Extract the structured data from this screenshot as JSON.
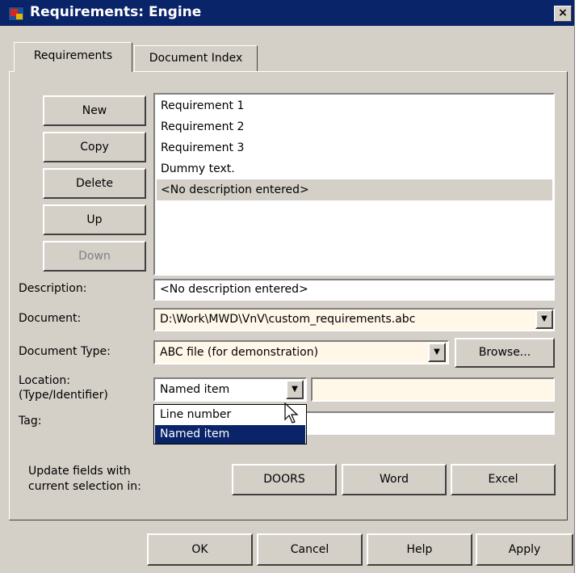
{
  "window": {
    "title": "Requirements: Engine",
    "close_label": "×"
  },
  "tabs": [
    {
      "label": "Requirements"
    },
    {
      "label": "Document Index"
    }
  ],
  "buttons": {
    "new": "New",
    "copy": "Copy",
    "delete": "Delete",
    "up": "Up",
    "down": "Down",
    "browse": "Browse...",
    "doors": "DOORS",
    "word": "Word",
    "excel": "Excel",
    "ok": "OK",
    "cancel": "Cancel",
    "help": "Help",
    "apply": "Apply"
  },
  "requirements_list": [
    "Requirement 1",
    "Requirement 2",
    "Requirement 3",
    "Dummy text.",
    "<No description entered>"
  ],
  "selected_index": 4,
  "labels": {
    "description": "Description:",
    "document": "Document:",
    "document_type": "Document Type:",
    "location_line1": "Location:",
    "location_line2": "(Type/Identifier)",
    "tag": "Tag:",
    "update_line1": "Update fields with",
    "update_line2": "current selection in:"
  },
  "fields": {
    "description": "<No description entered>",
    "document": "D:\\Work\\MWD\\VnV\\custom_requirements.abc",
    "document_type": "ABC  file (for demonstration)",
    "location_type": "Named item",
    "location_identifier": "",
    "tag": ""
  },
  "location_dropdown_options": [
    "Line number",
    "Named item"
  ],
  "location_dropdown_highlighted": "Named item",
  "colors": {
    "titlebar": "#0a246a",
    "dialog": "#d4d0c8",
    "field_cream": "#fff7e8",
    "highlight": "#0a246a"
  }
}
